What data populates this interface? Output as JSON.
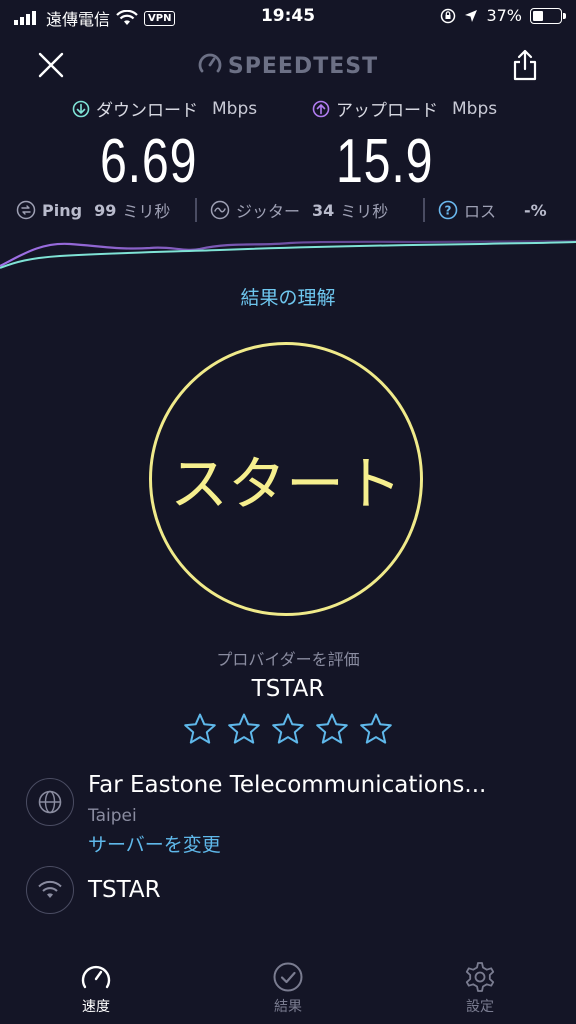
{
  "status_bar": {
    "carrier": "遠傳電信",
    "vpn": "VPN",
    "time": "19:45",
    "battery": "37%",
    "battery_level": 0.37
  },
  "header": {
    "brand": "SPEEDTEST"
  },
  "download": {
    "label": "ダウンロード",
    "unit": "Mbps",
    "value": "6.69",
    "color": "#7fe3d6"
  },
  "upload": {
    "label": "アップロード",
    "unit": "Mbps",
    "value": "15.9",
    "color": "#b07cf0"
  },
  "stats": {
    "ping_label": "Ping",
    "ping_value": "99",
    "ping_unit": "ミリ秒",
    "jitter_label": "ジッター",
    "jitter_value": "34",
    "jitter_unit": "ミリ秒",
    "loss_label": "ロス",
    "loss_value": "-%"
  },
  "understand_link": "結果の理解",
  "start_button": {
    "label": "スタート",
    "color": "#f0ea8a"
  },
  "rating": {
    "label": "プロバイダーを評価",
    "provider": "TSTAR",
    "stars_total": 5,
    "stars_filled": 0
  },
  "server": {
    "name": "Far Eastone Telecommunications...",
    "city": "Taipei",
    "change_label": "サーバーを変更"
  },
  "connection": {
    "isp": "TSTAR"
  },
  "tabs": [
    {
      "label": "速度",
      "icon": "speedometer-icon",
      "active": true
    },
    {
      "label": "結果",
      "icon": "check-circle-icon",
      "active": false
    },
    {
      "label": "設定",
      "icon": "gear-icon",
      "active": false
    }
  ]
}
